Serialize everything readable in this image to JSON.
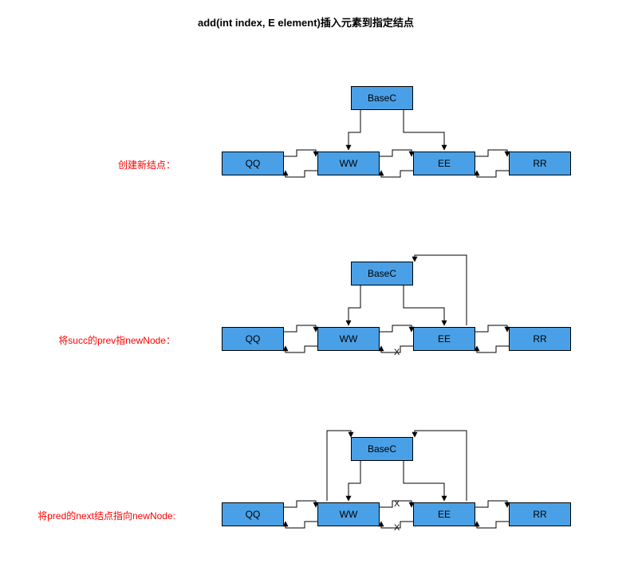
{
  "title": "add(int index, E element)插入元素到指定结点",
  "steps": [
    {
      "caption": "创建新结点："
    },
    {
      "caption": "将succ的prev指newNode："
    },
    {
      "caption": "将pred的next结点指向newNode:"
    }
  ],
  "node_labels": {
    "base": "BaseC",
    "n0": "QQ",
    "n1": "WW",
    "n2": "EE",
    "n3": "RR"
  },
  "marks": {
    "x": "X"
  },
  "colors": {
    "node_fill": "#4aa0e6",
    "node_stroke": "#000000",
    "caption": "#ff0000",
    "arrow": "#000000"
  }
}
